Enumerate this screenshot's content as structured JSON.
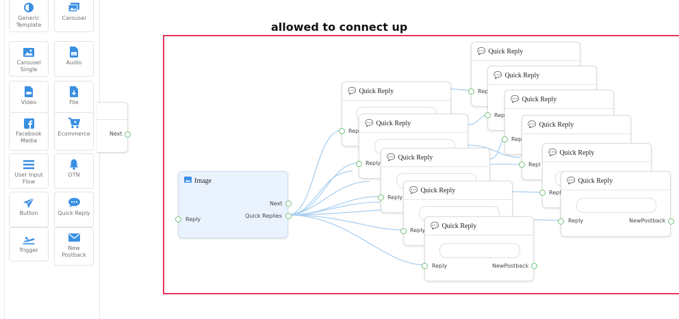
{
  "sidebar": {
    "tiles": [
      {
        "label": "Generic\nTemplate",
        "icon": "contrast-icon"
      },
      {
        "label": "Carousel",
        "icon": "images-icon"
      },
      {
        "label": "Carousel\nSingle",
        "icon": "image-icon"
      },
      {
        "label": "Audio",
        "icon": "audio-file-icon"
      },
      {
        "label": "Video",
        "icon": "video-file-icon"
      },
      {
        "label": "File",
        "icon": "download-file-icon"
      },
      {
        "label": "Facebook\nMedia",
        "icon": "facebook-icon"
      },
      {
        "label": "Ecommerce",
        "icon": "cart-icon"
      },
      {
        "label": "User Input\nFlow",
        "icon": "menu-lines-icon"
      },
      {
        "label": "OTN",
        "icon": "bell-icon"
      },
      {
        "label": "Button",
        "icon": "send-icon"
      },
      {
        "label": "Quick Reply",
        "icon": "chat-bubble-icon"
      },
      {
        "label": "Trigger",
        "icon": "plane-icon"
      },
      {
        "label": "New\nPostback",
        "icon": "envelope-icon"
      }
    ]
  },
  "annotation": {
    "title": "allowed to connect up",
    "frame_color": "#e6325a"
  },
  "partial_node": {
    "next_label": "Next"
  },
  "image_node": {
    "title": "Image",
    "reply_label": "Reply",
    "next_label": "Next",
    "quick_replies_label": "Quick Replies"
  },
  "quick_reply_nodes": {
    "title": "Quick Reply",
    "reply_label": "Reply",
    "postback_label": "NewPostback",
    "truncated_reply_label": "Rep",
    "truncated_reply_label2": "Repl"
  },
  "colors": {
    "accent": "#3b8fe3",
    "wire": "#a9cff0",
    "port": "#6fbf73"
  }
}
